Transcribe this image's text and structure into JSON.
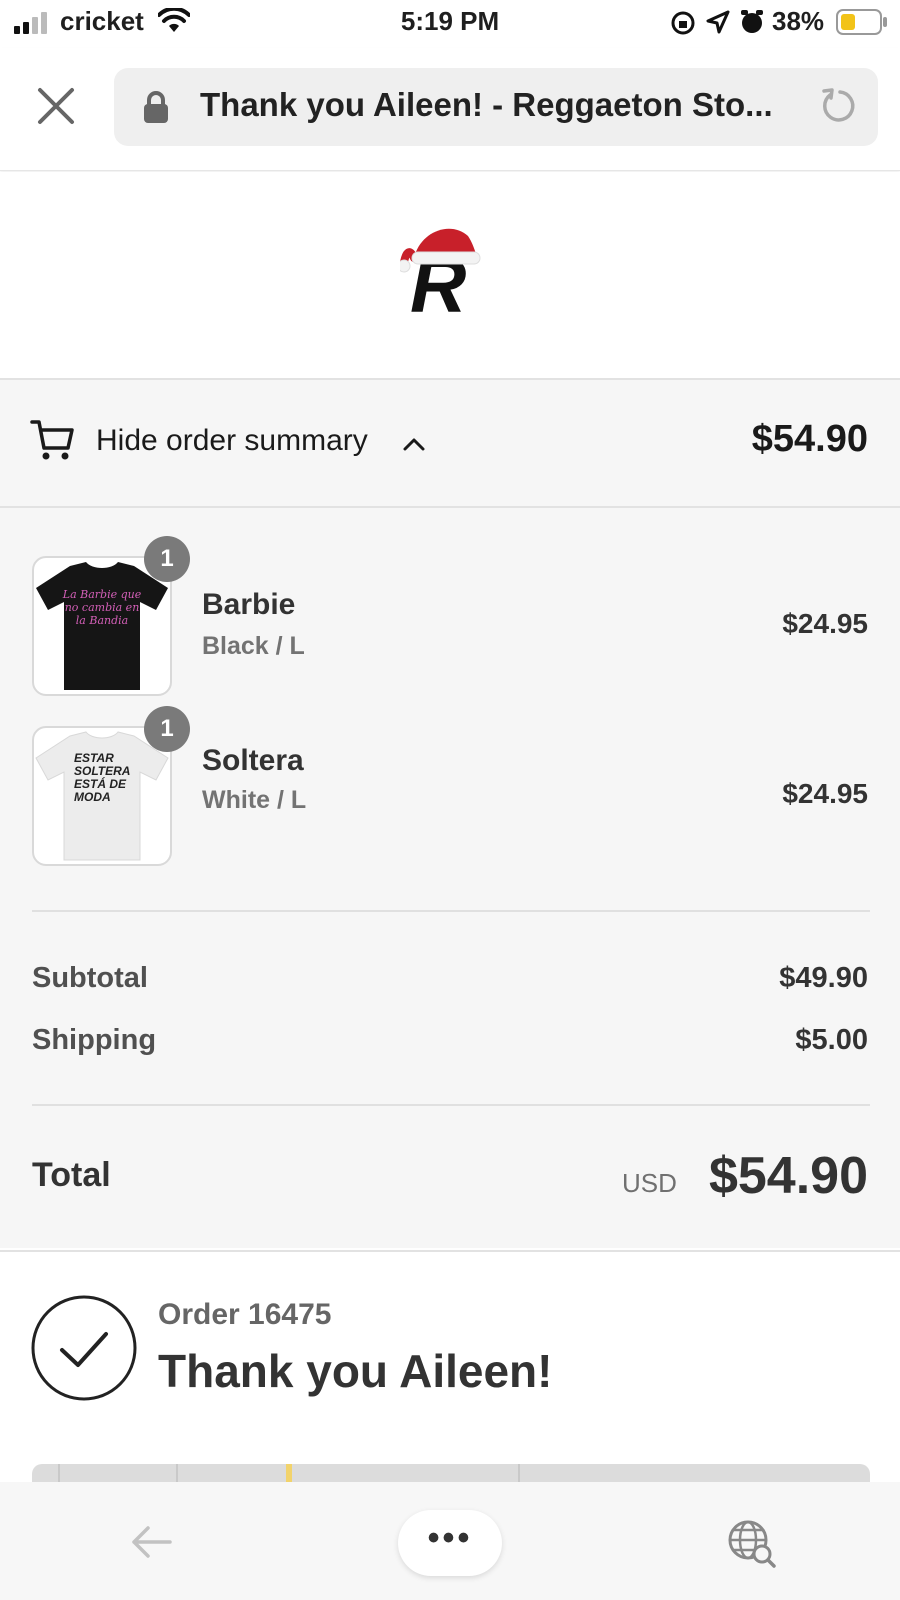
{
  "status_bar": {
    "carrier": "cricket",
    "time": "5:19 PM",
    "battery": "38%"
  },
  "browser": {
    "page_title": "Thank you Aileen! - Reggaeton Sto...",
    "close_icon": "close-icon",
    "lock_icon": "lock-icon",
    "reload_icon": "reload-icon"
  },
  "store": {
    "logo_letter": "R"
  },
  "order_summary": {
    "toggle_label": "Hide order summary",
    "toggle_total": "$54.90",
    "items": [
      {
        "name": "Barbie",
        "variant": "Black / L",
        "price": "$24.95",
        "quantity": "1",
        "shirt_color": "#151515",
        "print_text": "La Barbie que no cambia en la Bandia"
      },
      {
        "name": "Soltera",
        "variant": "White / L",
        "price": "$24.95",
        "quantity": "1",
        "shirt_color": "#ececec",
        "print_text": "ESTAR SOLTERA ESTÁ DE MODA"
      }
    ],
    "subtotal_label": "Subtotal",
    "subtotal_value": "$49.90",
    "shipping_label": "Shipping",
    "shipping_value": "$5.00",
    "total_label": "Total",
    "total_currency": "USD",
    "total_value": "$54.90"
  },
  "confirmation": {
    "order_number": "Order 16475",
    "title": "Thank you Aileen!"
  },
  "bottom_nav": {
    "more_label": "•••"
  },
  "colors": {
    "background_summary": "#f6f6f6",
    "text_primary": "#333333",
    "text_secondary": "#737373",
    "santa_hat_red": "#c8202a"
  }
}
